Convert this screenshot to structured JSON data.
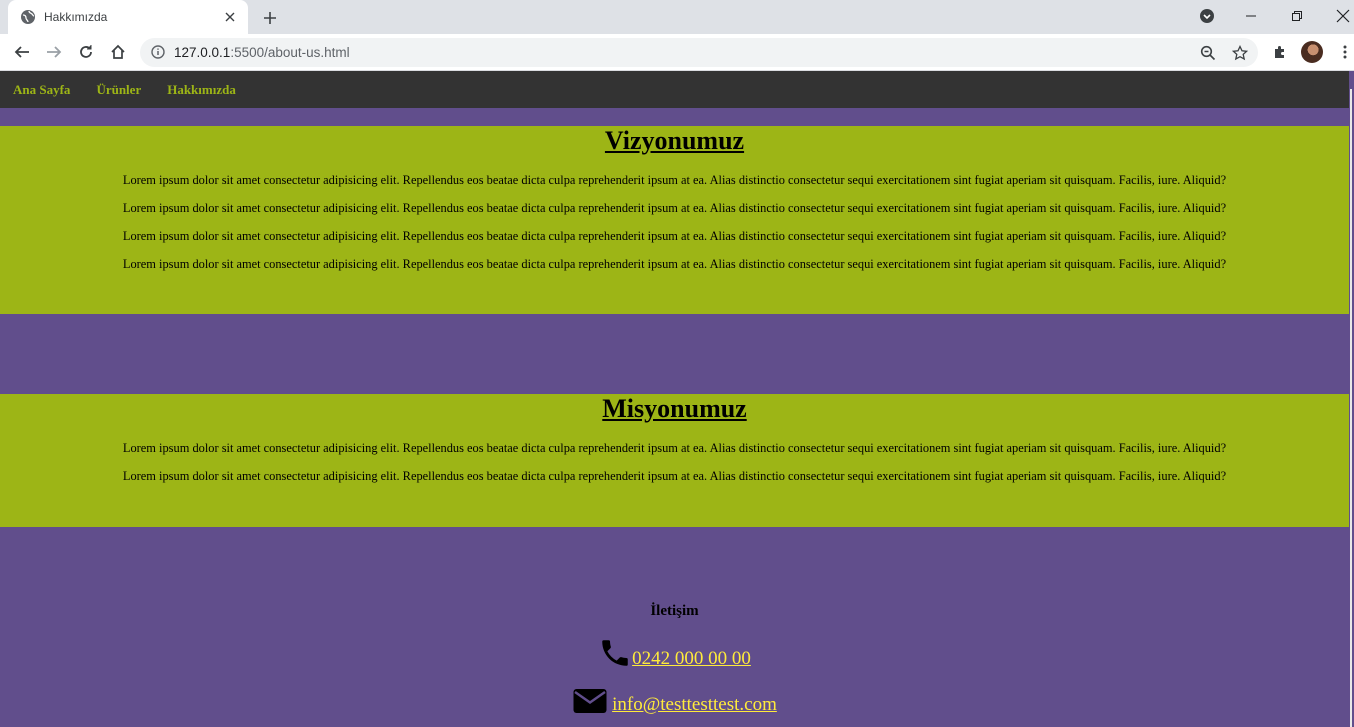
{
  "browser": {
    "tab_title": "Hakkımızda",
    "url_host": "127.0.0.1",
    "url_rest": ":5500/about-us.html",
    "icons": [
      "globe-icon",
      "close-icon",
      "plus-icon",
      "back-icon",
      "forward-icon",
      "reload-icon",
      "home-icon",
      "info-icon",
      "zoom-icon",
      "star-icon",
      "extensions-icon",
      "menu-icon"
    ]
  },
  "nav": {
    "items": [
      {
        "label": "Ana Sayfa"
      },
      {
        "label": "Ürünler"
      },
      {
        "label": "Hakkımızda"
      }
    ]
  },
  "vision": {
    "title": "Vizyonumuz",
    "paragraphs": [
      "Lorem ipsum dolor sit amet consectetur adipisicing elit. Repellendus eos beatae dicta culpa reprehenderit ipsum at ea. Alias distinctio consectetur sequi exercitationem sint fugiat aperiam sit quisquam. Facilis, iure. Aliquid?",
      "Lorem ipsum dolor sit amet consectetur adipisicing elit. Repellendus eos beatae dicta culpa reprehenderit ipsum at ea. Alias distinctio consectetur sequi exercitationem sint fugiat aperiam sit quisquam. Facilis, iure. Aliquid?",
      "Lorem ipsum dolor sit amet consectetur adipisicing elit. Repellendus eos beatae dicta culpa reprehenderit ipsum at ea. Alias distinctio consectetur sequi exercitationem sint fugiat aperiam sit quisquam. Facilis, iure. Aliquid?",
      "Lorem ipsum dolor sit amet consectetur adipisicing elit. Repellendus eos beatae dicta culpa reprehenderit ipsum at ea. Alias distinctio consectetur sequi exercitationem sint fugiat aperiam sit quisquam. Facilis, iure. Aliquid?"
    ]
  },
  "mission": {
    "title": "Misyonumuz",
    "paragraphs": [
      "Lorem ipsum dolor sit amet consectetur adipisicing elit. Repellendus eos beatae dicta culpa reprehenderit ipsum at ea. Alias distinctio consectetur sequi exercitationem sint fugiat aperiam sit quisquam. Facilis, iure. Aliquid?",
      "Lorem ipsum dolor sit amet consectetur adipisicing elit. Repellendus eos beatae dicta culpa reprehenderit ipsum at ea. Alias distinctio consectetur sequi exercitationem sint fugiat aperiam sit quisquam. Facilis, iure. Aliquid?"
    ]
  },
  "footer": {
    "heading": "İletişim",
    "phone": "0242 000 00 00",
    "email": "info@testtesttest.com"
  },
  "colors": {
    "page_bg": "#614e8c",
    "section_bg": "#9db516",
    "navbar_bg": "#333333",
    "nav_link": "#9db516",
    "contact_link": "#ffeb3b"
  }
}
